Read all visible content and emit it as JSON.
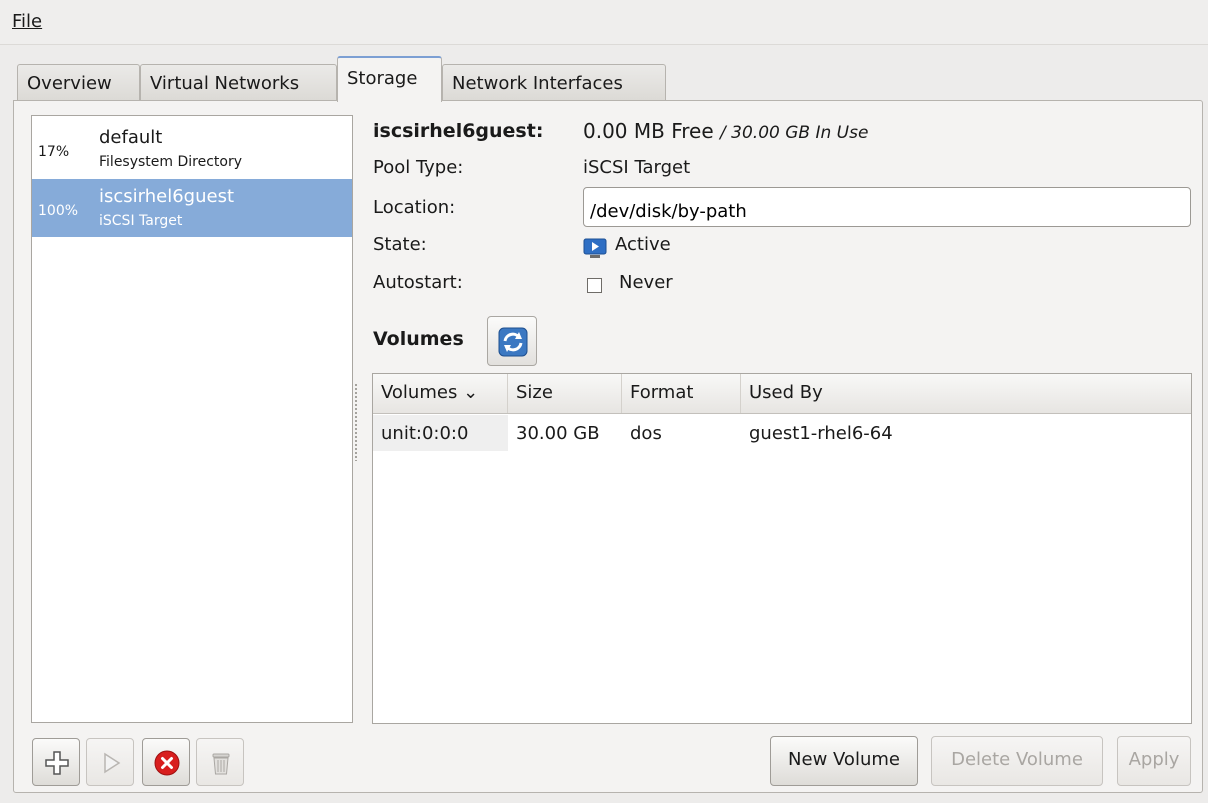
{
  "menu": {
    "file_label": "File"
  },
  "tabs": [
    {
      "label": "Overview"
    },
    {
      "label": "Virtual Networks"
    },
    {
      "label": "Storage"
    },
    {
      "label": "Network Interfaces"
    }
  ],
  "active_tab": "Storage",
  "pools": [
    {
      "percent": "17%",
      "name": "default",
      "type": "Filesystem Directory",
      "selected": false
    },
    {
      "percent": "100%",
      "name": "iscsirhel6guest",
      "type": "iSCSI Target",
      "selected": true
    }
  ],
  "details": {
    "pool_name": "iscsirhel6guest:",
    "free": "0.00 MB Free",
    "in_use": "/ 30.00 GB In Use",
    "pool_type_label": "Pool Type:",
    "pool_type_value": "iSCSI Target",
    "location_label": "Location:",
    "location_value": "/dev/disk/by-path",
    "state_label": "State:",
    "state_value": "Active",
    "autostart_label": "Autostart:",
    "autostart_value": "Never",
    "autostart_checked": false
  },
  "volumes": {
    "heading": "Volumes",
    "columns": [
      "Volumes",
      "Size",
      "Format",
      "Used By"
    ],
    "sort_indicator": "⌄",
    "rows": [
      {
        "name": "unit:0:0:0",
        "size": "30.00 GB",
        "format": "dos",
        "used_by": "guest1-rhel6-64"
      }
    ]
  },
  "buttons": {
    "new_volume": "New Volume",
    "delete_volume": "Delete Volume",
    "apply": "Apply"
  },
  "colors": {
    "selection": "#86abd9",
    "active_tab_accent": "#7c9fd3",
    "delete_red": "#d81e1e",
    "refresh_blue": "#3b78c2"
  }
}
